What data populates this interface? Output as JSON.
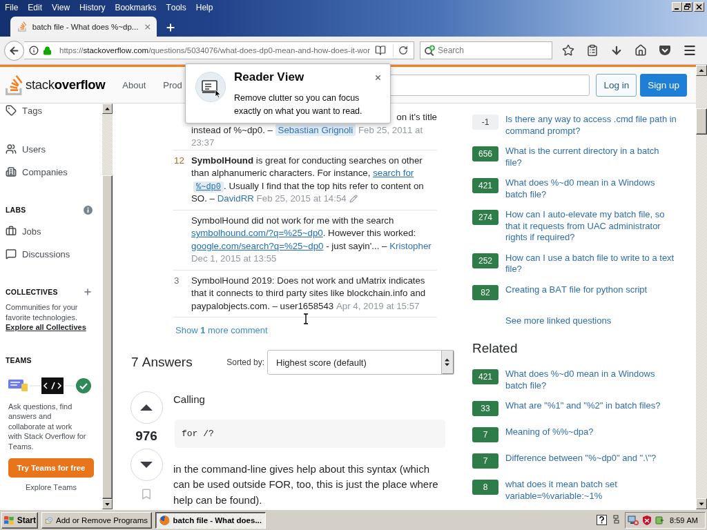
{
  "browser": {
    "menu": [
      "File",
      "Edit",
      "View",
      "History",
      "Bookmarks",
      "Tools",
      "Help"
    ],
    "tabs": [
      {
        "title": "batch file - What does %~dp...",
        "selected": true
      }
    ],
    "url": {
      "scheme": "https://",
      "host": "stackoverflow.com",
      "path": "/questions/5034076/what-does-dp0-mean-and-how-does-it-wor"
    },
    "search": {
      "placeholder": "Search"
    }
  },
  "reader_popup": {
    "title": "Reader View",
    "text": "Remove clutter so you can focus exactly on what you want to read."
  },
  "site_header": {
    "logo": "stack**overflow**",
    "nav": [
      "About",
      "Prod"
    ],
    "buttons": [
      {
        "kind": "outline",
        "label": "Log in"
      },
      {
        "kind": "primary",
        "label": "Sign up"
      }
    ]
  },
  "left_nav": {
    "items": [
      {
        "label": "Tags",
        "selected": false
      },
      {
        "label": "Users",
        "selected": false
      },
      {
        "label": "Companies",
        "selected": false
      }
    ],
    "labs": {
      "heading": "LABS",
      "items": [
        {
          "label": "Jobs",
          "selected": false
        },
        {
          "label": "Discussions",
          "selected": false
        }
      ]
    },
    "collectives": {
      "heading": "COLLECTIVES",
      "text": "Communities for your favorite technologies.",
      "link": "Explore all Collectives"
    },
    "teams": {
      "heading": "TEAMS",
      "text": "Ask questions, find answers and collaborate at work with Stack Overflow for Teams.",
      "button": "Try Teams for free",
      "link": "Explore Teams"
    }
  },
  "comments": [
    {
      "cut_line": "on it's title",
      "parts": [
        {
          "kind": "text",
          "text": "instead of %~dp0. – "
        }
      ],
      "author": {
        "kind": "owner",
        "name": "Sebastian Grignoli"
      },
      "date": "Feb 25, 2011 at 23:37",
      "edited": false
    },
    {
      "score": "12",
      "hot": true,
      "parts": [
        {
          "kind": "text",
          "text": "**SymbolHound** is great for conducting searches on other than alphanumeric characters. For instance, "
        },
        {
          "kind": "link",
          "text": "search for"
        },
        {
          "kind": "code_link",
          "text": "%~dp0"
        },
        {
          "kind": "text",
          "text": ". Usually I find that the top hits refer to content on SO. – "
        }
      ],
      "author": {
        "kind": "link",
        "name": "DavidRR"
      },
      "date": "Feb 25, 2015 at 14:54",
      "edited": true
    },
    {
      "parts": [
        {
          "kind": "text",
          "text": "SymbolHound did not work for me with the search "
        },
        {
          "kind": "link",
          "text": "symbolhound.com/?q=%25~dp0"
        },
        {
          "kind": "text",
          "text": ". However this worked: "
        },
        {
          "kind": "link",
          "text": "google.com/search?q=%25~dp0"
        },
        {
          "kind": "text",
          "text": " - just sayin'... – "
        }
      ],
      "author": {
        "kind": "link",
        "name": "Kristopher"
      },
      "date": "Dec 1, 2015 at 13:55",
      "edited": false
    },
    {
      "score": "3",
      "hot": false,
      "parts": [
        {
          "kind": "text",
          "text": "SymbolHound 2019: Does not work and uMatrix indicates that it connects to third party sites like blockchain.info and paypalobjects.com. – "
        }
      ],
      "author": {
        "kind": "plain",
        "name": "user1658543"
      },
      "date": "Apr 4, 2019 at 15:57",
      "edited": false
    }
  ],
  "show_more": "Show **1** more comment",
  "answers_header": {
    "count": "7 Answers",
    "sort_label": "Sorted by:",
    "sort_value": "Highest score (default)"
  },
  "answer": {
    "score": "976",
    "blocks": [
      {
        "kind": "paragraph",
        "text": "Calling"
      },
      {
        "kind": "code",
        "text": "for /?"
      },
      {
        "kind": "paragraph",
        "text": "in the command-line gives help about this syntax (which can be used outside FOR, too, this is just the place where help can be found)."
      }
    ]
  },
  "linked": {
    "items": [
      {
        "score": "-1",
        "accepted": false,
        "title": "Is there any way to access .cmd file path in command prompt?"
      },
      {
        "score": "656",
        "accepted": true,
        "title": "What is the current directory in a batch file?"
      },
      {
        "score": "421",
        "accepted": true,
        "title": "What does %~d0 mean in a Windows batch file?"
      },
      {
        "score": "274",
        "accepted": true,
        "title": "How can I auto-elevate my batch file, so that it requests from UAC administrator rights if required?"
      },
      {
        "score": "252",
        "accepted": true,
        "title": "How can I use a batch file to write to a text file?"
      },
      {
        "score": "82",
        "accepted": true,
        "title": "Creating a BAT file for python script"
      }
    ],
    "more": "See more linked questions"
  },
  "related": {
    "heading": "Related",
    "items": [
      {
        "score": "421",
        "accepted": true,
        "title": "What does %~d0 mean in a Windows batch file?"
      },
      {
        "score": "33",
        "accepted": true,
        "title": "What are \"%1\" and \"%2\" in batch files?"
      },
      {
        "score": "7",
        "accepted": true,
        "title": "Meaning of %%~dpa?"
      },
      {
        "score": "7",
        "accepted": true,
        "title": "Difference between \"%~dp0\" and \".\\\"?"
      },
      {
        "score": "8",
        "accepted": true,
        "title": "what does it mean batch set variable=%variable:~1%"
      }
    ]
  },
  "taskbar": {
    "start": "Start",
    "buttons": [
      {
        "label": "Add or Remove Programs",
        "selected": false
      },
      {
        "label": "batch file - What does...",
        "selected": true
      }
    ],
    "clock": "8:59 AM"
  }
}
